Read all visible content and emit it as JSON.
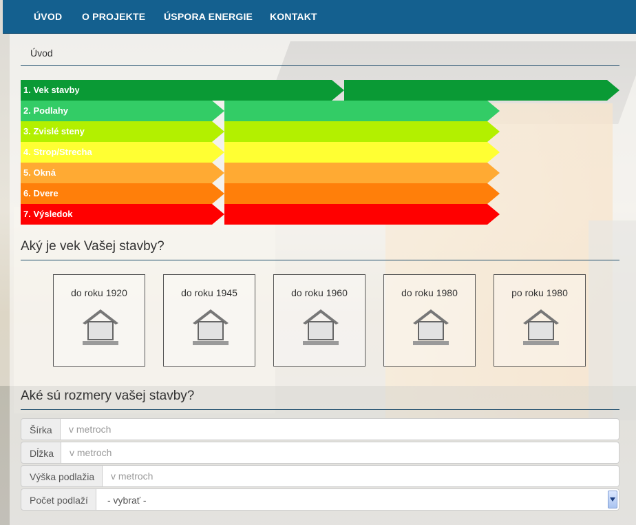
{
  "nav": {
    "items": [
      {
        "label": "ÚVOD"
      },
      {
        "label": "O PROJEKTE"
      },
      {
        "label": "ÚSPORA ENERGIE"
      },
      {
        "label": "KONTAKT"
      }
    ]
  },
  "breadcrumb": "Úvod",
  "steps": [
    {
      "label": "1. Vek stavby",
      "color": "#0a9a35"
    },
    {
      "label": "2. Podlahy",
      "color": "#33cc66"
    },
    {
      "label": "3. Zvislé steny",
      "color": "#b3f000"
    },
    {
      "label": "4. Strop/Strecha",
      "color": "#ffff33"
    },
    {
      "label": "5. Okná",
      "color": "#ffaa33"
    },
    {
      "label": "6. Dvere",
      "color": "#ff7f0a"
    },
    {
      "label": "7. Výsledok",
      "color": "#ff0000"
    }
  ],
  "age_section": {
    "title": "Aký je vek Vašej stavby?",
    "options": [
      {
        "label": "do roku 1920",
        "icon": "house-icon"
      },
      {
        "label": "do roku 1945",
        "icon": "house-icon"
      },
      {
        "label": "do roku 1960",
        "icon": "house-icon"
      },
      {
        "label": "do roku 1980",
        "icon": "house-icon"
      },
      {
        "label": "po roku 1980",
        "icon": "house-icon"
      }
    ]
  },
  "dimensions_section": {
    "title": "Aké sú rozmery vašej stavby?",
    "fields": {
      "width": {
        "label": "Šírka",
        "placeholder": "v metroch",
        "value": ""
      },
      "length": {
        "label": "Dĺžka",
        "placeholder": "v metroch",
        "value": ""
      },
      "floor_height": {
        "label": "Výška podlažia",
        "placeholder": "v metroch",
        "value": ""
      },
      "floor_count": {
        "label": "Počet podlaží",
        "selected": "- vybrať -"
      }
    }
  }
}
